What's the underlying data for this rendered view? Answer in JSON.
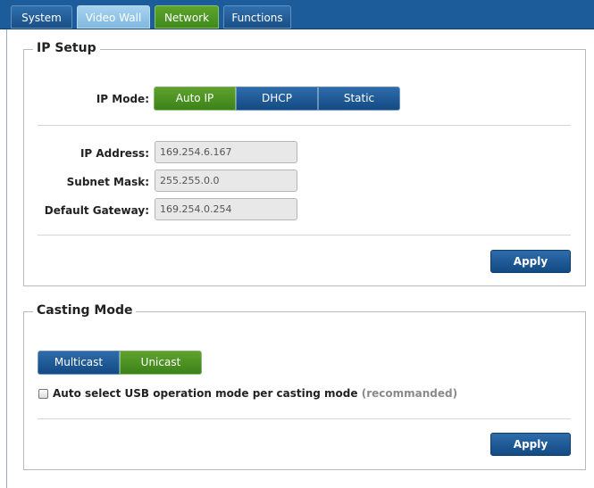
{
  "tabs": [
    {
      "label": "System"
    },
    {
      "label": "Video Wall"
    },
    {
      "label": "Network"
    },
    {
      "label": "Functions"
    }
  ],
  "ip_setup": {
    "title": "IP Setup",
    "ip_mode_label": "IP Mode:",
    "modes": [
      {
        "label": "Auto IP",
        "selected": true
      },
      {
        "label": "DHCP",
        "selected": false
      },
      {
        "label": "Static",
        "selected": false
      }
    ],
    "ip_address_label": "IP Address:",
    "ip_address_value": "169.254.6.167",
    "subnet_mask_label": "Subnet Mask:",
    "subnet_mask_value": "255.255.0.0",
    "gateway_label": "Default Gateway:",
    "gateway_value": "169.254.0.254",
    "apply_label": "Apply"
  },
  "casting_mode": {
    "title": "Casting Mode",
    "modes": [
      {
        "label": "Multicast",
        "selected": false
      },
      {
        "label": "Unicast",
        "selected": true
      }
    ],
    "auto_usb_label": "Auto select USB operation mode per casting mode",
    "auto_usb_hint": "(recommanded)",
    "auto_usb_checked": false,
    "apply_label": "Apply"
  },
  "colors": {
    "tab_bar": "#1d5c9a",
    "selected_green": "#4e9524",
    "button_blue": "#1d5c9a"
  }
}
